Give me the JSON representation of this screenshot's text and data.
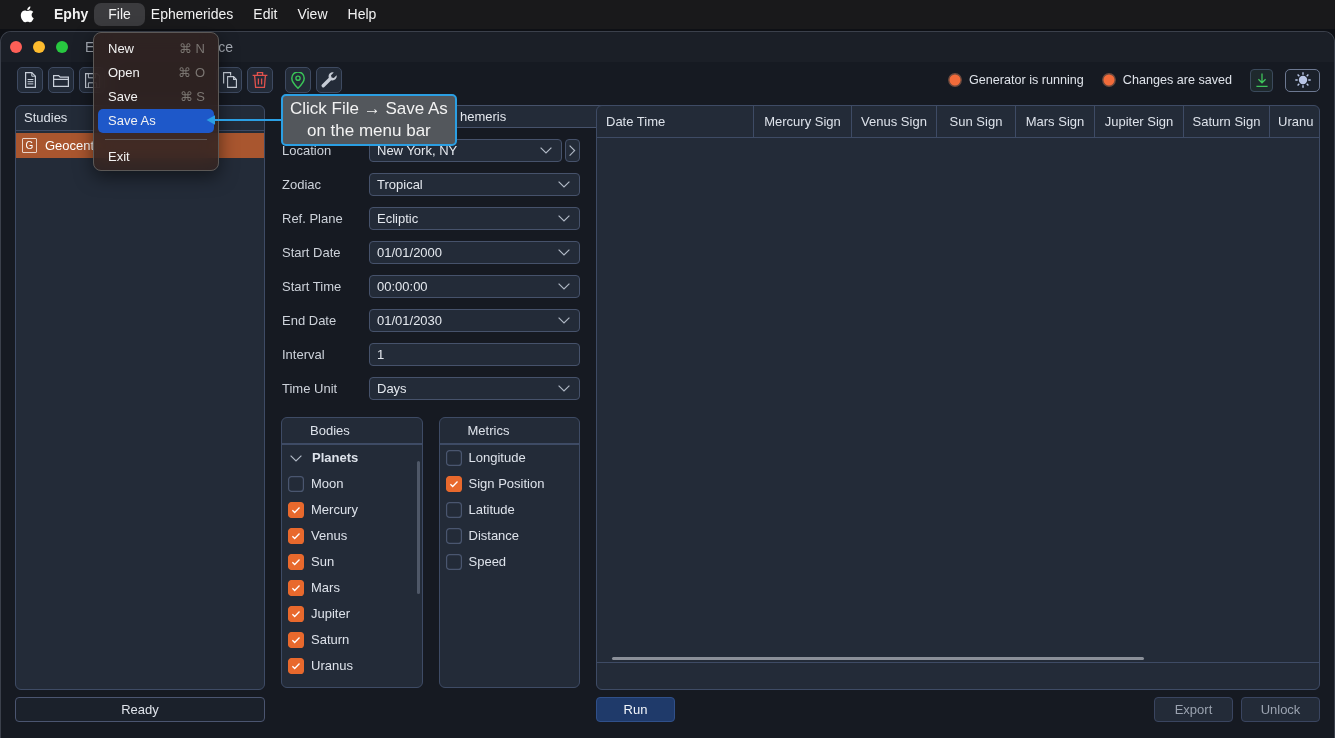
{
  "menu_bar": {
    "app_name": "Ephy",
    "menus": [
      {
        "label": "File",
        "selected": true
      },
      {
        "label": "Ephemerides",
        "selected": false
      },
      {
        "label": "Edit",
        "selected": false
      },
      {
        "label": "View",
        "selected": false
      },
      {
        "label": "Help",
        "selected": false
      }
    ]
  },
  "file_menu": {
    "items": [
      {
        "kind": "item",
        "label": "New",
        "shortcut": "⌘ N",
        "selected": false
      },
      {
        "kind": "item",
        "label": "Open",
        "shortcut": "⌘ O",
        "selected": false
      },
      {
        "kind": "item",
        "label": "Save",
        "shortcut": "⌘ S",
        "selected": false
      },
      {
        "kind": "item",
        "label": "Save As",
        "selected": true
      },
      {
        "kind": "separator"
      },
      {
        "kind": "item",
        "label": "Exit",
        "selected": false
      }
    ]
  },
  "window": {
    "title_parts": [
      "E",
      "ce"
    ]
  },
  "toolbar": {
    "statuses": [
      {
        "label": "Generator is running",
        "color": "#f26b3a"
      },
      {
        "label": "Changes are saved",
        "color": "#f26b3a"
      }
    ]
  },
  "annotation": {
    "text": "Click File → Save As\non the menu bar"
  },
  "studies": {
    "title": "Studies",
    "items": [
      {
        "badge": "G",
        "label": "Geocent",
        "selected": true
      }
    ],
    "status": "Ready"
  },
  "form": {
    "fields": [
      {
        "kind": "input",
        "value": "hemeris"
      },
      {
        "kind": "select",
        "label": "Location",
        "value": "New York, NY",
        "expander": true
      },
      {
        "kind": "select",
        "label": "Zodiac",
        "value": "Tropical"
      },
      {
        "kind": "select",
        "label": "Ref. Plane",
        "value": "Ecliptic"
      },
      {
        "kind": "select",
        "label": "Start Date",
        "value": "01/01/2000"
      },
      {
        "kind": "select",
        "label": "Start Time",
        "value": "00:00:00"
      },
      {
        "kind": "select",
        "label": "End Date",
        "value": "01/01/2030"
      },
      {
        "kind": "input",
        "label": "Interval",
        "value": "1"
      },
      {
        "kind": "select",
        "label": "Time Unit",
        "value": "Days"
      }
    ]
  },
  "bodies": {
    "title": "Bodies",
    "groups": [
      {
        "label": "Planets",
        "expanded": true,
        "children": [
          {
            "label": "Moon",
            "checked": false
          },
          {
            "label": "Mercury",
            "checked": true
          },
          {
            "label": "Venus",
            "checked": true
          },
          {
            "label": "Sun",
            "checked": true
          },
          {
            "label": "Mars",
            "checked": true
          },
          {
            "label": "Jupiter",
            "checked": true
          },
          {
            "label": "Saturn",
            "checked": true
          },
          {
            "label": "Uranus",
            "checked": true
          }
        ]
      }
    ]
  },
  "metrics": {
    "title": "Metrics",
    "items": [
      {
        "label": "Longitude",
        "checked": false
      },
      {
        "label": "Sign Position",
        "checked": true
      },
      {
        "label": "Latitude",
        "checked": false
      },
      {
        "label": "Distance",
        "checked": false
      },
      {
        "label": "Speed",
        "checked": false
      }
    ]
  },
  "results_table": {
    "columns": [
      "Date Time",
      "Mercury Sign",
      "Venus Sign",
      "Sun Sign",
      "Mars Sign",
      "Jupiter Sign",
      "Saturn Sign",
      "Uranu"
    ]
  },
  "actions": [
    {
      "label": "Run",
      "kind": "primary",
      "disabled": false
    },
    {
      "label": "Export",
      "kind": "secondary",
      "disabled": true
    },
    {
      "label": "Unlock",
      "kind": "secondary",
      "disabled": true
    }
  ]
}
